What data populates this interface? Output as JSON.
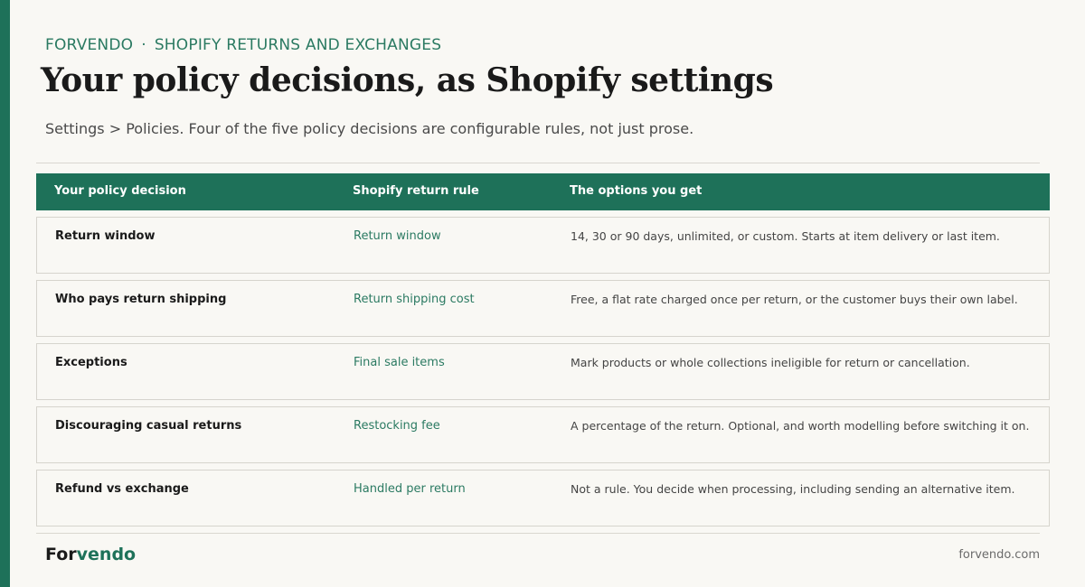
{
  "header": {
    "brand_label": "FORVENDO",
    "separator": "·",
    "section_label": "SHOPIFY RETURNS AND EXCHANGES",
    "title": "Your policy decisions, as Shopify settings",
    "subtitle": "Settings > Policies. Four of the five policy decisions are configurable rules, not just prose."
  },
  "table": {
    "columns": [
      "Your policy decision",
      "Shopify return rule",
      "The options you get"
    ],
    "rows": [
      {
        "decision": "Return window",
        "rule": "Return window",
        "options": "14, 30 or 90 days, unlimited, or custom. Starts at item delivery or last item."
      },
      {
        "decision": "Who pays return shipping",
        "rule": "Return shipping cost",
        "options": "Free, a flat rate charged once per return, or the customer buys their own label."
      },
      {
        "decision": "Exceptions",
        "rule": "Final sale items",
        "options": "Mark products or whole collections ineligible for return or cancellation."
      },
      {
        "decision": "Discouraging casual returns",
        "rule": "Restocking fee",
        "options": "A percentage of the return. Optional, and worth modelling before switching it on."
      },
      {
        "decision": "Refund vs exchange",
        "rule": "Handled per return",
        "options": "Not a rule. You decide when processing, including sending an alternative item."
      }
    ]
  },
  "footer": {
    "logo_part1": "For",
    "logo_part2": "vendo",
    "url": "forvendo.com"
  },
  "colors": {
    "accent": "#1e7159",
    "background": "#f9f8f4"
  }
}
